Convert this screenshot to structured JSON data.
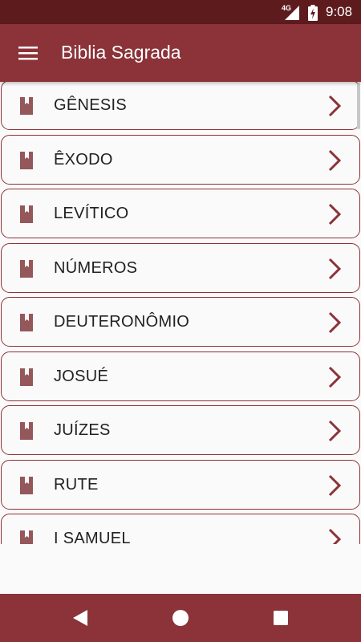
{
  "status_bar": {
    "network": "4G",
    "time": "9:08"
  },
  "app_bar": {
    "title": "Biblia Sagrada",
    "menu_icon": "hamburger-menu-icon"
  },
  "colors": {
    "primary": "#8b3338",
    "status": "#5e1b1e",
    "icon": "#94575a"
  },
  "books": [
    {
      "label": "GÊNESIS"
    },
    {
      "label": "ÊXODO"
    },
    {
      "label": "LEVÍTICO"
    },
    {
      "label": "NÚMEROS"
    },
    {
      "label": "DEUTERONÔMIO"
    },
    {
      "label": "JOSUÉ"
    },
    {
      "label": "JUÍZES"
    },
    {
      "label": "RUTE"
    },
    {
      "label": "I SAMUEL"
    }
  ],
  "nav_bar": {
    "back_icon": "back-triangle-icon",
    "home_icon": "home-circle-icon",
    "recents_icon": "recents-square-icon"
  }
}
